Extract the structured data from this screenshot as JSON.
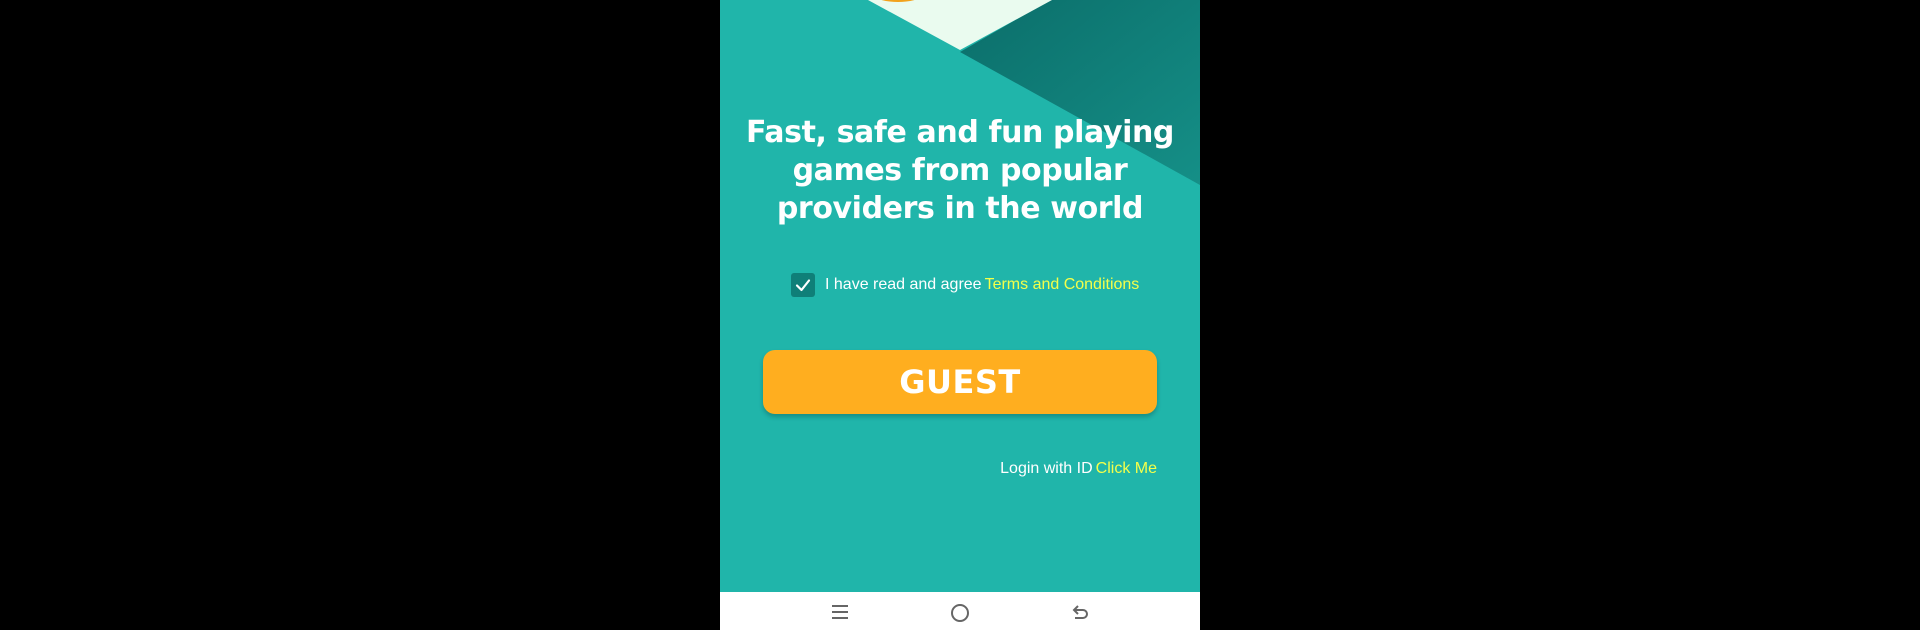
{
  "app": {
    "headline": "Fast, safe and fun playing games from popular providers in the world",
    "agreement": {
      "checked": true,
      "text": "I have read and agree",
      "link_text": "Terms and Conditions"
    },
    "guest_button_label": "GUEST",
    "login": {
      "text": "Login with ID",
      "link_text": "Click Me"
    }
  },
  "navbar": {
    "icons": [
      "menu-icon",
      "home-icon",
      "back-icon"
    ]
  },
  "colors": {
    "background_teal": "#20b5aa",
    "accent_yellow_link": "#f4ff4a",
    "guest_button": "#ffae1f",
    "checkbox": "#0f7f78",
    "navbar": "#ffffff"
  }
}
